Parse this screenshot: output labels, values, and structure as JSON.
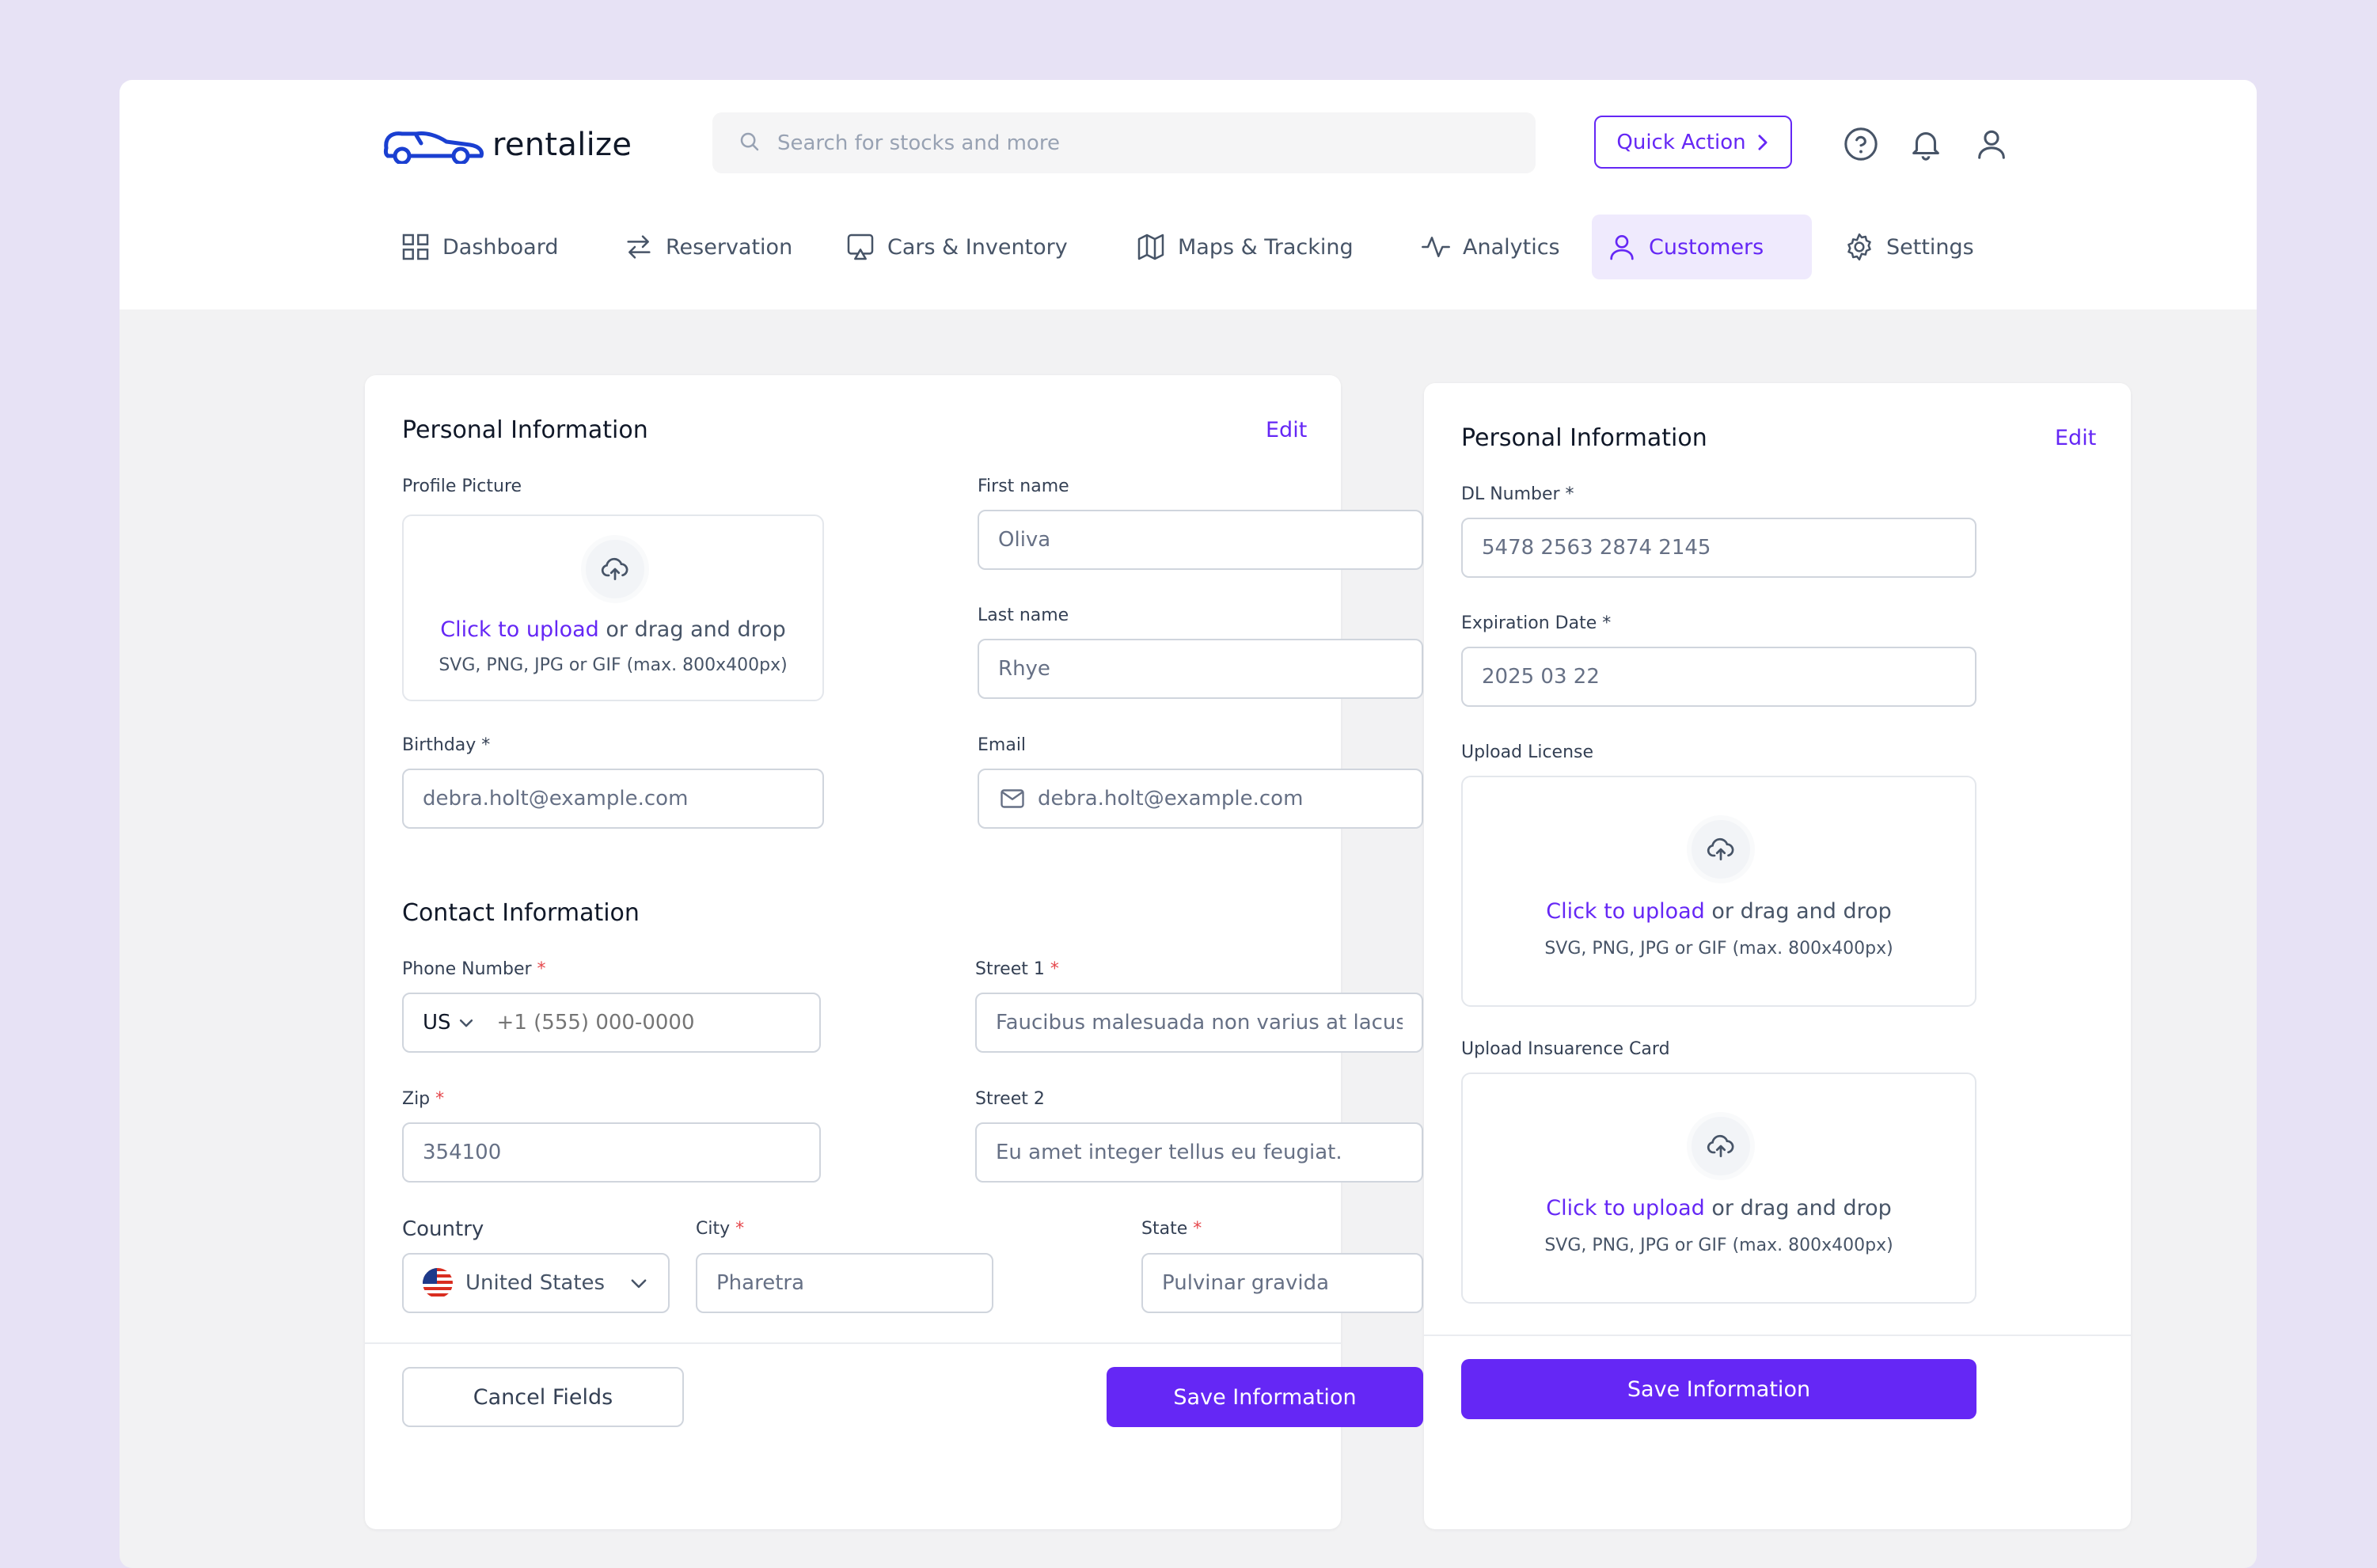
{
  "app": {
    "logo_text": "rentalize",
    "search_placeholder": "Search for stocks and more",
    "quick_action_label": "Quick Action",
    "header_icons": [
      "help-icon",
      "bell-icon",
      "user-icon"
    ]
  },
  "nav": {
    "items": [
      {
        "label": "Dashboard",
        "icon": "grid-icon",
        "active": false
      },
      {
        "label": "Reservation",
        "icon": "swap-arrows-icon",
        "active": false
      },
      {
        "label": "Cars & Inventory",
        "icon": "monitor-icon",
        "active": false
      },
      {
        "label": "Maps & Tracking",
        "icon": "map-icon",
        "active": false
      },
      {
        "label": "Analytics",
        "icon": "activity-icon",
        "active": false
      },
      {
        "label": "Customers",
        "icon": "user-icon",
        "active": true
      },
      {
        "label": "Settings",
        "icon": "gear-icon",
        "active": false
      }
    ]
  },
  "left_card": {
    "title": "Personal Information",
    "edit_label": "Edit",
    "profile_picture_label": "Profile Picture",
    "upload": {
      "link": "Click to upload",
      "rest": " or drag and drop",
      "hint": "SVG, PNG, JPG or GIF (max. 800x400px)"
    },
    "first_name": {
      "label": "First name",
      "value": "Oliva"
    },
    "last_name": {
      "label": "Last name",
      "value": "Rhye"
    },
    "birthday": {
      "label": "Birthday",
      "req": " *",
      "value": "debra.holt@example.com"
    },
    "email": {
      "label": "Email",
      "value": "debra.holt@example.com"
    },
    "contact_title": "Contact Information",
    "phone": {
      "label": "Phone Number",
      "req": " *",
      "country": "US",
      "placeholder": "+1 (555) 000-0000"
    },
    "street1": {
      "label": "Street 1",
      "req": " *",
      "value": "Faucibus malesuada non varius at lacus"
    },
    "zip": {
      "label": "Zip",
      "req": " *",
      "value": "354100"
    },
    "street2": {
      "label": "Street 2",
      "value": "Eu amet integer tellus eu feugiat."
    },
    "country": {
      "label": "Country",
      "value": "United States"
    },
    "city": {
      "label": "City",
      "req": " *",
      "value": "Pharetra"
    },
    "state": {
      "label": "State",
      "req": " *",
      "value": "Pulvinar gravida"
    },
    "cancel_label": "Cancel Fields",
    "save_label": "Save Information"
  },
  "right_card": {
    "title": "Personal Information",
    "edit_label": "Edit",
    "dl_number": {
      "label": "DL Number *",
      "value": "5478 2563 2874 2145"
    },
    "expiration": {
      "label": "Expiration Date *",
      "value": "2025 03 22"
    },
    "upload_license_label": "Upload License",
    "upload_insurance_label": "Upload Insuarence Card",
    "upload": {
      "link": "Click to upload",
      "rest": " or drag and drop",
      "hint": "SVG, PNG, JPG or GIF (max. 800x400px)"
    },
    "save_label": "Save Information"
  },
  "colors": {
    "accent": "#6527f5",
    "background": "#e7e2f5",
    "required": "#e5484d"
  }
}
